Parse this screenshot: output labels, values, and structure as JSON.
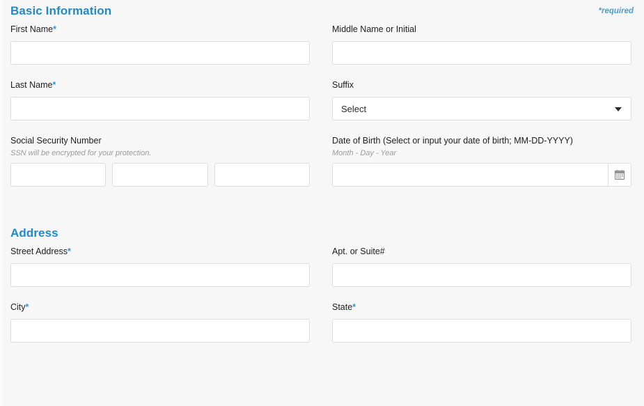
{
  "form": {
    "required_note": "*required",
    "sections": [
      {
        "id": "basic-information",
        "title": "Basic Information",
        "fields": {
          "first_name": {
            "label": "First Name",
            "required_mark": "*",
            "value": ""
          },
          "middle_name": {
            "label": "Middle Name or Initial",
            "value": ""
          },
          "last_name": {
            "label": "Last Name",
            "required_mark": "*",
            "value": ""
          },
          "suffix": {
            "label": "Suffix",
            "selected": "Select",
            "icon": "chevron-down-icon"
          },
          "ssn": {
            "label": "Social Security Number",
            "hint": "SSN will be encrypted for your protection.",
            "part1": "",
            "part2": "",
            "part3": ""
          },
          "dob": {
            "label": "Date of Birth (Select or input your date of birth; MM-DD-YYYY)",
            "hint": "Month - Day - Year",
            "value": "",
            "icon": "calendar-icon"
          }
        }
      },
      {
        "id": "address",
        "title": "Address",
        "fields": {
          "street_address": {
            "label": "Street Address",
            "required_mark": "*",
            "value": ""
          },
          "apt_suite": {
            "label": "Apt. or Suite#",
            "value": ""
          },
          "city": {
            "label": "City",
            "required_mark": "*",
            "value": ""
          },
          "state": {
            "label": "State",
            "required_mark": "*",
            "value": ""
          }
        }
      }
    ]
  },
  "colors": {
    "heading_blue": "#2289c9",
    "required_blue": "#2f97d6",
    "page_background": "#f7f7f7",
    "input_border": "#dcdcdc",
    "label_text": "#1d1d1d",
    "hint_text": "#9b9b9b"
  }
}
